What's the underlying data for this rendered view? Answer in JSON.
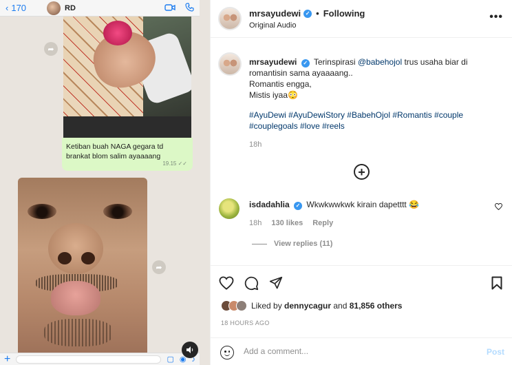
{
  "whatsapp": {
    "back_label": "170",
    "contact_name": "RD",
    "message_text": "Ketiban buah NAGA gegara td brankat blom salim ayaaaang",
    "message_time": "19.15"
  },
  "post": {
    "author": "mrsayudewi",
    "separator": "•",
    "follow_status": "Following",
    "audio": "Original Audio",
    "more_icon": "more-options-icon",
    "caption": {
      "username": "mrsayudewi",
      "line1_prefix": "Terinspirasi ",
      "mention": "@babehojol",
      "line1_suffix": " trus usaha biar di romantisin sama ayaaaang..",
      "line2": "Romantis engga,",
      "line3": "Mistis iyaa😳",
      "hashtags": "#AyuDewi #AyuDewiStory #BabehOjol #Romantis #couple #couplegoals #love #reels",
      "time": "18h"
    },
    "comment": {
      "username": "isdadahlia",
      "text": "Wkwkwwkwk kirain dapetttt 😂",
      "time": "18h",
      "likes": "130 likes",
      "reply_label": "Reply",
      "view_replies": "View replies (11)"
    },
    "likes": {
      "prefix": "Liked by ",
      "user": "dennycagur",
      "middle": " and ",
      "others": "81,856 others"
    },
    "posted_ago": "18 HOURS AGO",
    "add_comment_placeholder": "Add a comment...",
    "post_label": "Post"
  },
  "colors": {
    "link": "#00376b",
    "verified": "#3897f0",
    "post_disabled": "#b3dbff",
    "wa_bubble": "#dcf8c6"
  }
}
